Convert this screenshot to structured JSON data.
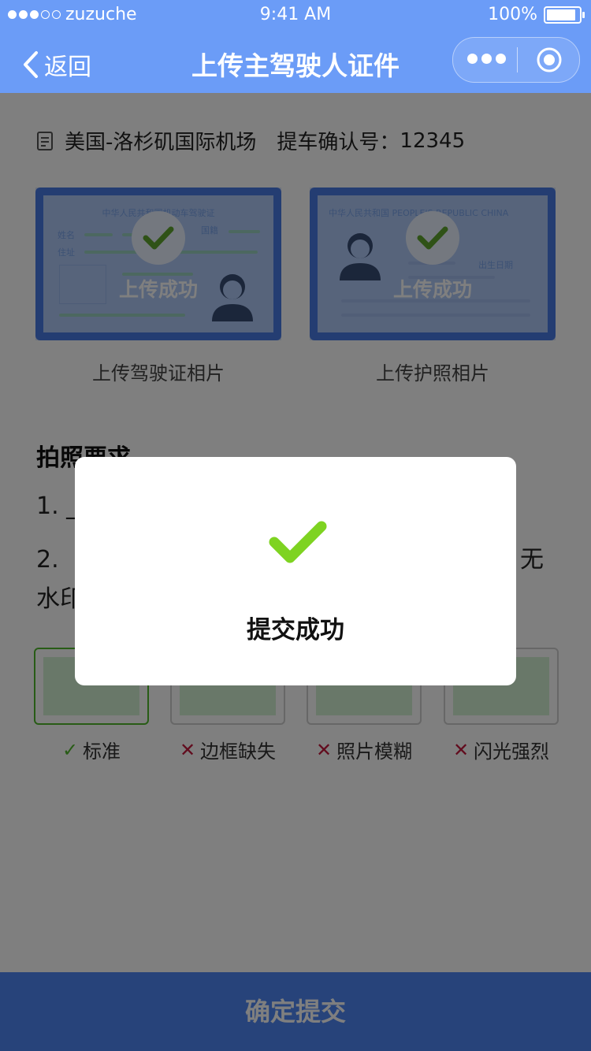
{
  "status_bar": {
    "carrier": "zuzuche",
    "time": "9:41 AM",
    "battery_text": "100%",
    "battery_level": 1.0
  },
  "nav": {
    "back_label": "返回",
    "title": "上传主驾驶人证件",
    "icons": [
      "chevron-left-icon",
      "more-dots-icon",
      "target-close-icon"
    ]
  },
  "order_info": {
    "location": "美国-洛杉矶国际机场",
    "confirm_label": "提车确认号：",
    "confirm_number": "12345"
  },
  "cards": [
    {
      "overlay_text": "上传成功",
      "caption": "上传驾驶证相片",
      "doc_header": "中华人民共和国机动车驾驶证",
      "doc_fields": [
        "姓名",
        "国籍",
        "住址"
      ]
    },
    {
      "overlay_text": "上传成功",
      "caption": "上传护照相片",
      "doc_header": "中华人民共和国 PEOPLE'S REPUBLIC CHINA",
      "doc_fields": [
        "出生日期"
      ]
    }
  ],
  "requirements": {
    "title": "拍照要求",
    "line1": "1.  _",
    "line2_start": "2.  ",
    "line2_end": "无",
    "line3": "水印"
  },
  "samples": [
    {
      "label": "标准",
      "ok": true
    },
    {
      "label": "边框缺失",
      "ok": false
    },
    {
      "label": "照片模糊",
      "ok": false
    },
    {
      "label": "闪光强烈",
      "ok": false
    }
  ],
  "submit_button": "确定提交",
  "toast": {
    "icon": "check-icon",
    "message": "提交成功"
  },
  "colors": {
    "brand_blue": "#6b9cf7",
    "button_blue": "#4f86f4",
    "success_green": "#7ed321",
    "error_red": "#c4183c"
  }
}
